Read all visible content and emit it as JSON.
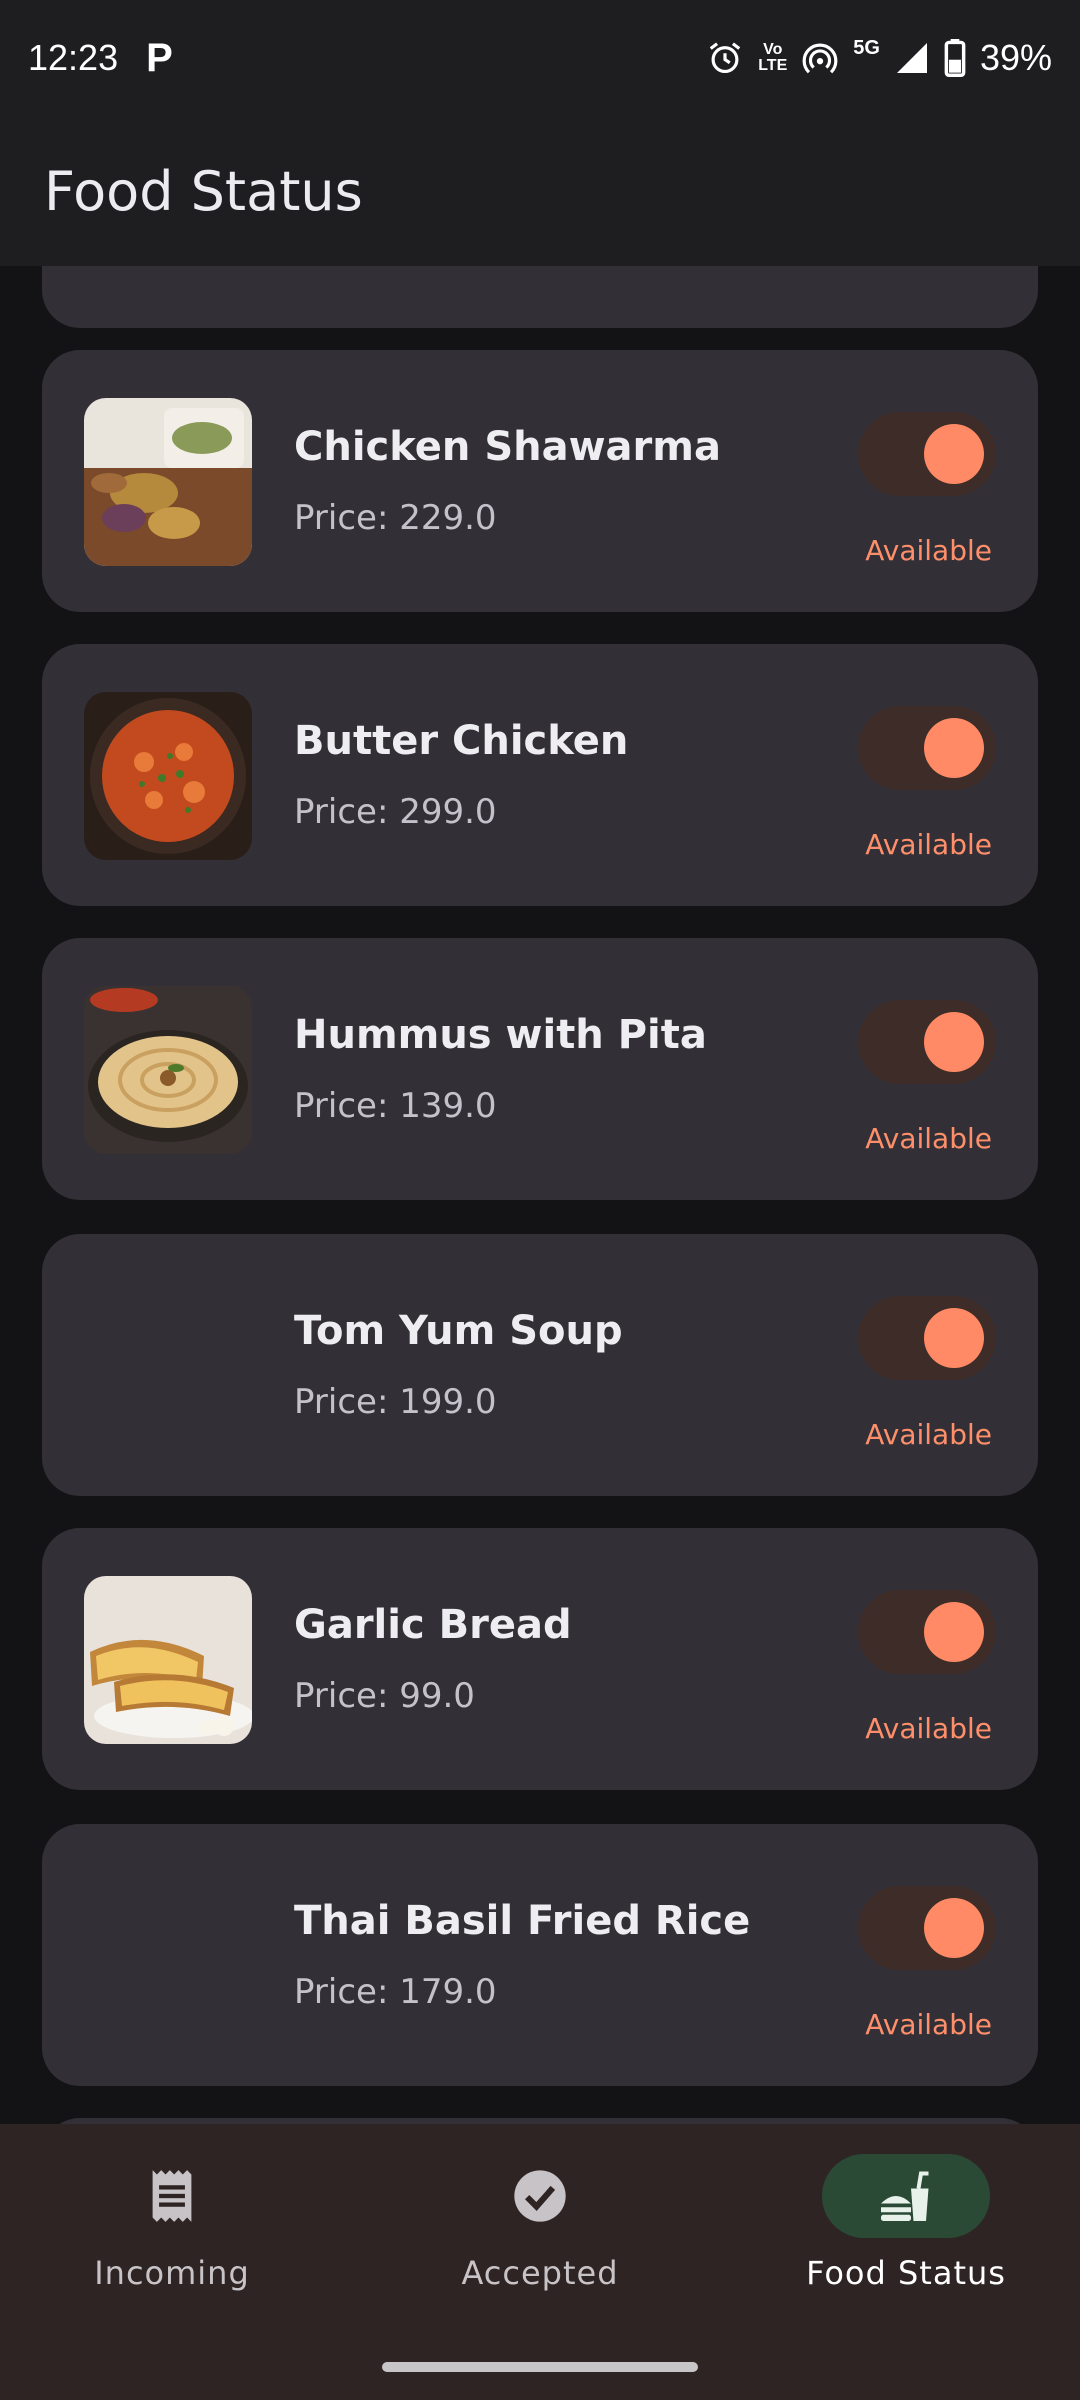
{
  "status_bar": {
    "time": "12:23",
    "notification_letter": "P",
    "volte_top": "Vo",
    "volte_bottom": "LTE",
    "network": "5G",
    "battery": "39%"
  },
  "app_bar": {
    "title": "Food Status"
  },
  "foods": [
    {
      "name": "Chicken Shawarma",
      "price": "Price: 229.0",
      "status": "Available",
      "available": true,
      "has_image": true
    },
    {
      "name": "Butter Chicken",
      "price": "Price: 299.0",
      "status": "Available",
      "available": true,
      "has_image": true
    },
    {
      "name": "Hummus with Pita",
      "price": "Price: 139.0",
      "status": "Available",
      "available": true,
      "has_image": true
    },
    {
      "name": "Tom Yum Soup",
      "price": "Price: 199.0",
      "status": "Available",
      "available": true,
      "has_image": false
    },
    {
      "name": "Garlic Bread",
      "price": "Price: 99.0",
      "status": "Available",
      "available": true,
      "has_image": true
    },
    {
      "name": "Thai Basil Fried Rice",
      "price": "Price: 179.0",
      "status": "Available",
      "available": true,
      "has_image": false
    }
  ],
  "bottom_nav": {
    "items": [
      {
        "label": "Incoming",
        "icon": "receipt-icon",
        "active": false
      },
      {
        "label": "Accepted",
        "icon": "check-circle-icon",
        "active": false
      },
      {
        "label": "Food Status",
        "icon": "fastfood-icon",
        "active": true
      }
    ]
  },
  "colors": {
    "accent": "#ff8a65",
    "card": "#323036",
    "background": "#131215",
    "nav_active": "#2b4a35"
  }
}
